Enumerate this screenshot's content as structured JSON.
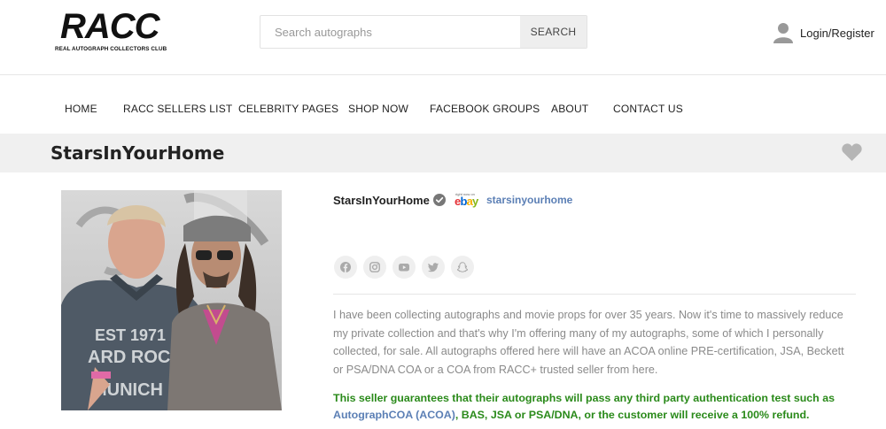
{
  "header": {
    "logo_main": "RACC",
    "logo_sub": "REAL AUTOGRAPH COLLECTORS CLUB",
    "search_placeholder": "Search autographs",
    "search_button": "SEARCH",
    "login_label": "Login/Register"
  },
  "nav": {
    "items": [
      "HOME",
      "RACC SELLERS LIST",
      "CELEBRITY PAGES",
      "SHOP NOW",
      "FACEBOOK GROUPS",
      "ABOUT",
      "CONTACT US"
    ]
  },
  "page": {
    "title": "StarsInYourHome"
  },
  "profile": {
    "seller_name": "StarsInYourHome",
    "ebay_right_now": "right now on",
    "ebay_word": [
      "e",
      "b",
      "a",
      "y"
    ],
    "ebay_link": "starsinyourhome",
    "socials": [
      "facebook-icon",
      "instagram-icon",
      "youtube-icon",
      "twitter-icon",
      "snapchat-icon"
    ],
    "bio": "I have been collecting autographs and movie props for over 35 years. Now it's time to massively reduce my private collection and that's why I'm offering many of my autographs, some of which I personally collected, for sale. All autographs offered here will have an ACOA online PRE-certification, JSA, Beckett or PSA/DNA COA or a COA from RACC+ trusted seller from here.",
    "guarantee_before": "This seller guarantees that their autographs will pass any third party authentication test such as ",
    "guarantee_link": "AutographCOA (ACOA)",
    "guarantee_after": ", BAS, JSA or PSA/DNA, or the customer will receive a 100% refund."
  },
  "colors": {
    "ebay_e": "#e53238",
    "ebay_b": "#0064d2",
    "ebay_a": "#f5af02",
    "ebay_y": "#86b817",
    "link": "#5b7fb5",
    "guarantee": "#2a8a1a"
  }
}
